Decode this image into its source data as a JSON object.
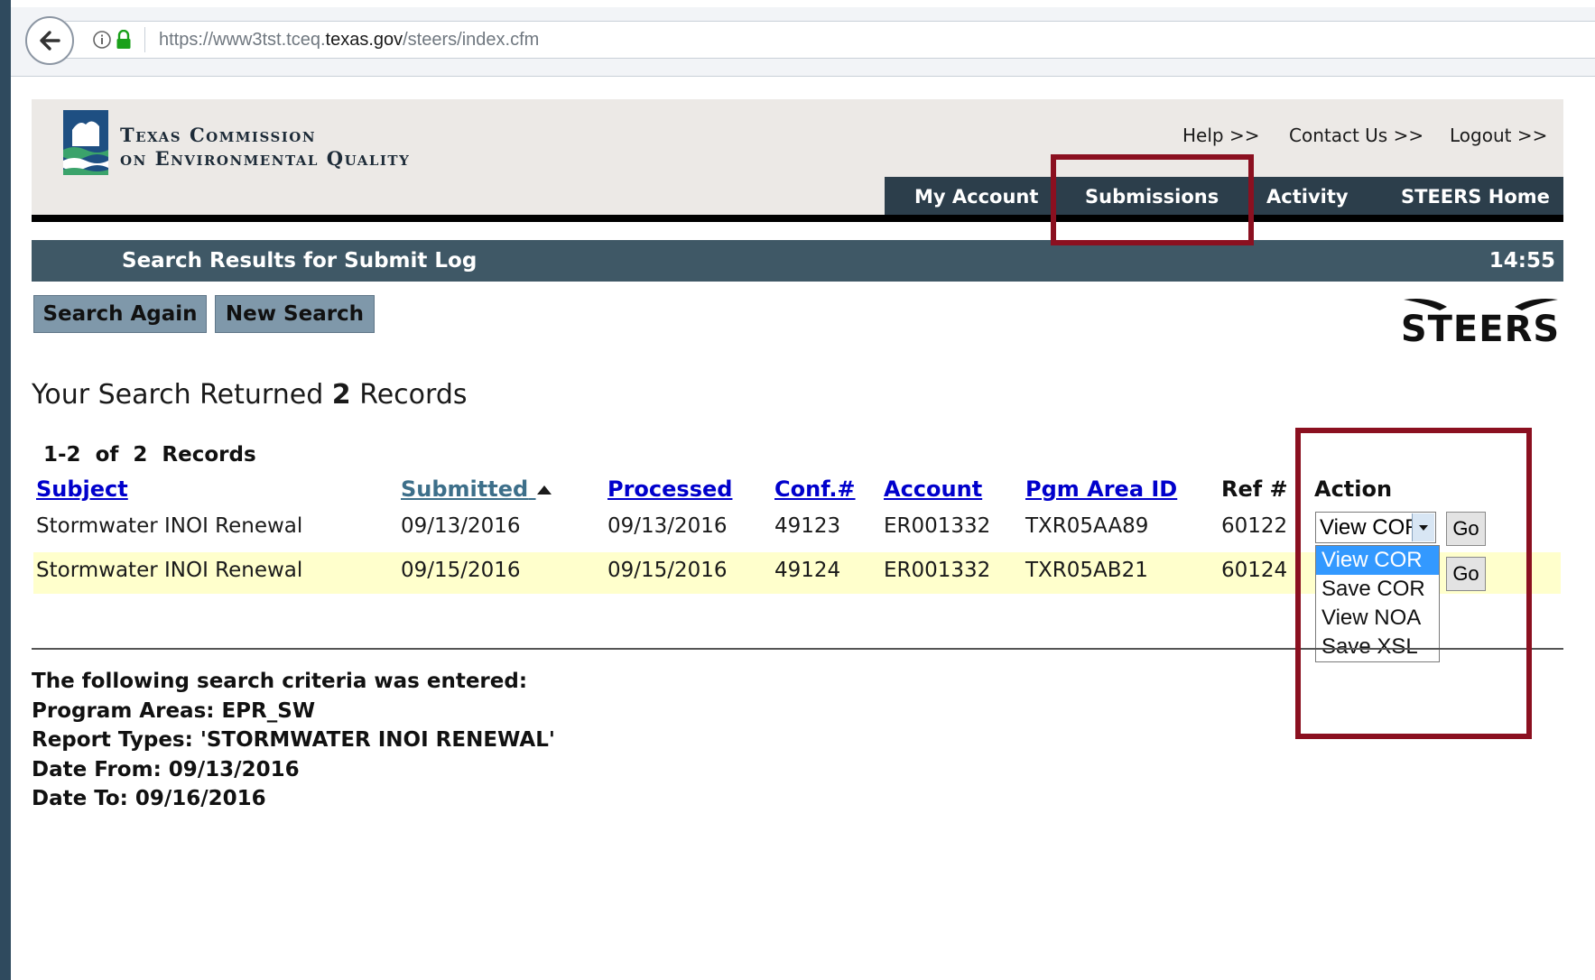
{
  "browser": {
    "url_prefix": "https://www3tst.tceq.",
    "url_domain": "texas.gov",
    "url_suffix": "/steers/index.cfm"
  },
  "header": {
    "org_line1": "Texas Commission",
    "org_line2": "on Environmental Quality",
    "help": "Help >>",
    "contact": "Contact Us >>",
    "logout": "Logout >>",
    "nav": [
      "My Account",
      "Submissions",
      "Activity",
      "STEERS Home"
    ]
  },
  "titlebar": {
    "title": "Search Results for Submit Log",
    "time": "14:55"
  },
  "buttons": {
    "search_again": "Search Again",
    "new_search": "New Search"
  },
  "steers_logo": "STEERS",
  "summary": {
    "prefix": "Your Search Returned",
    "count": "2",
    "suffix": "Records"
  },
  "range": "1-2  of  2  Records",
  "columns": [
    "Subject",
    "Submitted",
    "Processed",
    "Conf.#",
    "Account",
    "Pgm Area ID",
    "Ref #",
    "Action"
  ],
  "rows": [
    {
      "subject": "Stormwater INOI Renewal",
      "submitted": "09/13/2016",
      "processed": "09/13/2016",
      "conf": "49123",
      "account": "ER001332",
      "pgm": "TXR05AA89",
      "ref": "60122"
    },
    {
      "subject": "Stormwater INOI Renewal",
      "submitted": "09/15/2016",
      "processed": "09/15/2016",
      "conf": "49124",
      "account": "ER001332",
      "pgm": "TXR05AB21",
      "ref": "60124"
    }
  ],
  "action": {
    "selected": "View COR",
    "go": "Go",
    "options": [
      "View COR",
      "Save COR",
      "View NOA",
      "Save XSL"
    ]
  },
  "criteria": {
    "intro": "The following search criteria was entered:",
    "program_areas": "Program Areas: EPR_SW",
    "report_types": "Report Types: 'STORMWATER INOI RENEWAL'",
    "date_from": "Date From: 09/13/2016",
    "date_to": "Date To: 09/16/2016"
  },
  "colors": {
    "highlight": "#8b1020",
    "navbar": "#2c3e4b",
    "titlebar": "#3f5866",
    "row_alt": "#ffffcc"
  }
}
